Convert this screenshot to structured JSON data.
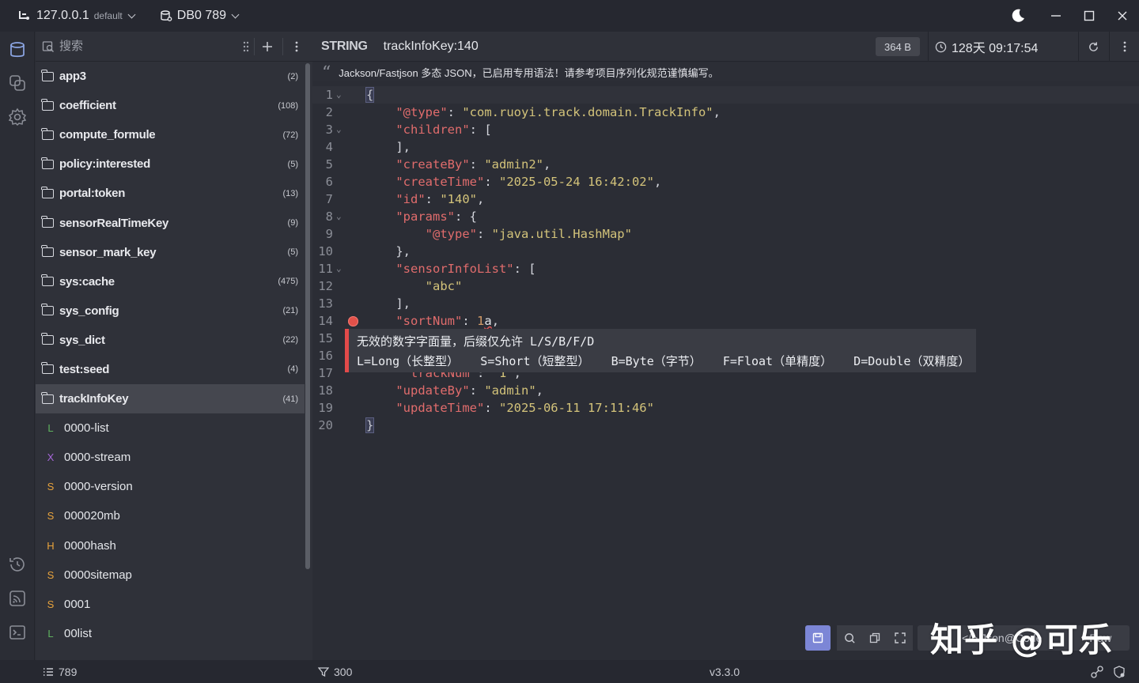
{
  "titlebar": {
    "host": "127.0.0.1",
    "host_sub": "default",
    "db": "DB0 789"
  },
  "key_search": {
    "placeholder": "搜索"
  },
  "key_tree": [
    {
      "kind": "folder",
      "name": "app3",
      "count": "(2)"
    },
    {
      "kind": "folder",
      "name": "coefficient",
      "count": "(108)"
    },
    {
      "kind": "folder",
      "name": "compute_formule",
      "count": "(72)"
    },
    {
      "kind": "folder",
      "name": "policy:interested",
      "count": "(5)"
    },
    {
      "kind": "folder",
      "name": "portal:token",
      "count": "(13)"
    },
    {
      "kind": "folder",
      "name": "sensorRealTimeKey",
      "count": "(9)"
    },
    {
      "kind": "folder",
      "name": "sensor_mark_key",
      "count": "(5)"
    },
    {
      "kind": "folder",
      "name": "sys:cache",
      "count": "(475)"
    },
    {
      "kind": "folder",
      "name": "sys_config",
      "count": "(21)"
    },
    {
      "kind": "folder",
      "name": "sys_dict",
      "count": "(22)"
    },
    {
      "kind": "folder",
      "name": "test:seed",
      "count": "(4)"
    },
    {
      "kind": "folder",
      "name": "trackInfoKey",
      "count": "(41)",
      "selected": true
    },
    {
      "kind": "key",
      "type": "L",
      "name": "0000-list"
    },
    {
      "kind": "key",
      "type": "X",
      "name": "0000-stream"
    },
    {
      "kind": "key",
      "type": "S",
      "name": "0000-version"
    },
    {
      "kind": "key",
      "type": "S",
      "name": "000020mb"
    },
    {
      "kind": "key",
      "type": "H",
      "name": "0000hash"
    },
    {
      "kind": "key",
      "type": "S",
      "name": "0000sitemap"
    },
    {
      "kind": "key",
      "type": "S",
      "name": "0001"
    },
    {
      "kind": "key",
      "type": "L",
      "name": "00list"
    }
  ],
  "type_colors": {
    "L": "#5fb35f",
    "X": "#a566d8",
    "S": "#e8a33c",
    "H": "#e8a33c"
  },
  "editor": {
    "type": "STRING",
    "key": "trackInfoKey:140",
    "size": "364 B",
    "ttl": "128天 09:17:54",
    "notice": "Jackson/Fastjson 多态 JSON，已启用专用语法！请参考项目序列化规范谨慎编写。",
    "lines": [
      {
        "n": "1",
        "fold": true,
        "seg": [
          [
            "brk",
            "{"
          ]
        ]
      },
      {
        "n": "2",
        "seg": [
          [
            "pl",
            "    "
          ],
          [
            "k",
            "\"@type\""
          ],
          [
            "pl",
            ": "
          ],
          [
            "v",
            "\"com.ruoyi.track.domain.TrackInfo\""
          ],
          [
            "pl",
            ","
          ]
        ]
      },
      {
        "n": "3",
        "fold": true,
        "seg": [
          [
            "pl",
            "    "
          ],
          [
            "k",
            "\"children\""
          ],
          [
            "pl",
            ": ["
          ]
        ]
      },
      {
        "n": "4",
        "seg": [
          [
            "pl",
            "    ],"
          ]
        ]
      },
      {
        "n": "5",
        "seg": [
          [
            "pl",
            "    "
          ],
          [
            "k",
            "\"createBy\""
          ],
          [
            "pl",
            ": "
          ],
          [
            "v",
            "\"admin2\""
          ],
          [
            "pl",
            ","
          ]
        ]
      },
      {
        "n": "6",
        "seg": [
          [
            "pl",
            "    "
          ],
          [
            "k",
            "\"createTime\""
          ],
          [
            "pl",
            ": "
          ],
          [
            "v",
            "\"2025-05-24 16:42:02\""
          ],
          [
            "pl",
            ","
          ]
        ]
      },
      {
        "n": "7",
        "seg": [
          [
            "pl",
            "    "
          ],
          [
            "k",
            "\"id\""
          ],
          [
            "pl",
            ": "
          ],
          [
            "v",
            "\"140\""
          ],
          [
            "pl",
            ","
          ]
        ]
      },
      {
        "n": "8",
        "fold": true,
        "seg": [
          [
            "pl",
            "    "
          ],
          [
            "k",
            "\"params\""
          ],
          [
            "pl",
            ": {"
          ]
        ]
      },
      {
        "n": "9",
        "seg": [
          [
            "pl",
            "        "
          ],
          [
            "k",
            "\"@type\""
          ],
          [
            "pl",
            ": "
          ],
          [
            "v",
            "\"java.util.HashMap\""
          ]
        ]
      },
      {
        "n": "10",
        "seg": [
          [
            "pl",
            "    },"
          ]
        ]
      },
      {
        "n": "11",
        "fold": true,
        "seg": [
          [
            "pl",
            "    "
          ],
          [
            "k",
            "\"sensorInfoList\""
          ],
          [
            "pl",
            ": ["
          ]
        ]
      },
      {
        "n": "12",
        "seg": [
          [
            "pl",
            "        "
          ],
          [
            "v",
            "\"abc\""
          ]
        ]
      },
      {
        "n": "13",
        "seg": [
          [
            "pl",
            "    ],"
          ]
        ]
      },
      {
        "n": "14",
        "error": true,
        "seg": [
          [
            "pl",
            "    "
          ],
          [
            "k",
            "\"sortNum\""
          ],
          [
            "pl",
            ": "
          ],
          [
            "num",
            "1"
          ],
          [
            "err",
            "a"
          ],
          [
            "pl",
            ","
          ]
        ]
      },
      {
        "n": "15",
        "seg": [
          [
            "pl",
            ""
          ]
        ]
      },
      {
        "n": "16",
        "seg": [
          [
            "pl",
            ""
          ]
        ]
      },
      {
        "n": "17",
        "seg": [
          [
            "pl",
            "     "
          ],
          [
            "k",
            "\"trackNum\""
          ],
          [
            "pl",
            ": "
          ],
          [
            "v",
            "\"1\""
          ],
          [
            "pl",
            ","
          ]
        ]
      },
      {
        "n": "18",
        "seg": [
          [
            "pl",
            "    "
          ],
          [
            "k",
            "\"updateBy\""
          ],
          [
            "pl",
            ": "
          ],
          [
            "v",
            "\"admin\""
          ],
          [
            "pl",
            ","
          ]
        ]
      },
      {
        "n": "19",
        "seg": [
          [
            "pl",
            "    "
          ],
          [
            "k",
            "\"updateTime\""
          ],
          [
            "pl",
            ": "
          ],
          [
            "v",
            "\"2025-06-11 17:11:46\""
          ]
        ]
      },
      {
        "n": "20",
        "seg": [
          [
            "brk",
            "}"
          ]
        ]
      }
    ],
    "tooltip_line1": "无效的数字字面量，后缀仅允许 L/S/B/F/D",
    "tooltip_line2": "L=Long（长整型）   S=Short（短整型）   B=Byte（字节）   F=Float（单精度）   D=Double（双精度）",
    "format_label": "</> Json@Code",
    "view_label": "Raw"
  },
  "watermark": "知乎 @可乐",
  "statusbar": {
    "key_count": "789",
    "filter_count": "300",
    "version": "v3.3.0"
  }
}
